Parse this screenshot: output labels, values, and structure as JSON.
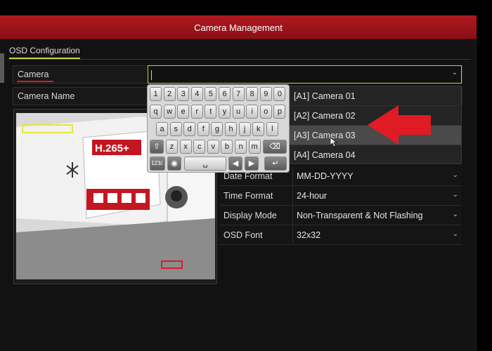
{
  "window": {
    "title": "Camera Management"
  },
  "tab": {
    "label": "OSD Configuration"
  },
  "camera_field": {
    "label": "Camera",
    "value": ""
  },
  "camera_name_field": {
    "label": "Camera Name"
  },
  "dropdown": {
    "options": [
      "[A1] Camera 01",
      "[A2] Camera 02",
      "[A3] Camera 03",
      "[A4] Camera 04"
    ],
    "highlighted_index": 2
  },
  "keyboard": {
    "row1": [
      "1",
      "2",
      "3",
      "4",
      "5",
      "6",
      "7",
      "8",
      "9",
      "0"
    ],
    "row2": [
      "q",
      "w",
      "e",
      "r",
      "t",
      "y",
      "u",
      "i",
      "o",
      "p"
    ],
    "row3": [
      "a",
      "s",
      "d",
      "f",
      "g",
      "h",
      "j",
      "k",
      "l"
    ],
    "row4": [
      "z",
      "x",
      "c",
      "v",
      "b",
      "n",
      "m"
    ],
    "mode_key": "123/.",
    "enter_icon": "enter-icon"
  },
  "osd_settings": [
    {
      "label": "Date Format",
      "value": "MM-DD-YYYY"
    },
    {
      "label": "Time Format",
      "value": "24-hour"
    },
    {
      "label": "Display Mode",
      "value": "Non-Transparent & Not Flashing"
    },
    {
      "label": "OSD Font",
      "value": "32x32"
    }
  ],
  "colors": {
    "title_bar": "#9a141b",
    "accent_yellow": "#c8d23a",
    "arrow_red": "#e01b24"
  }
}
